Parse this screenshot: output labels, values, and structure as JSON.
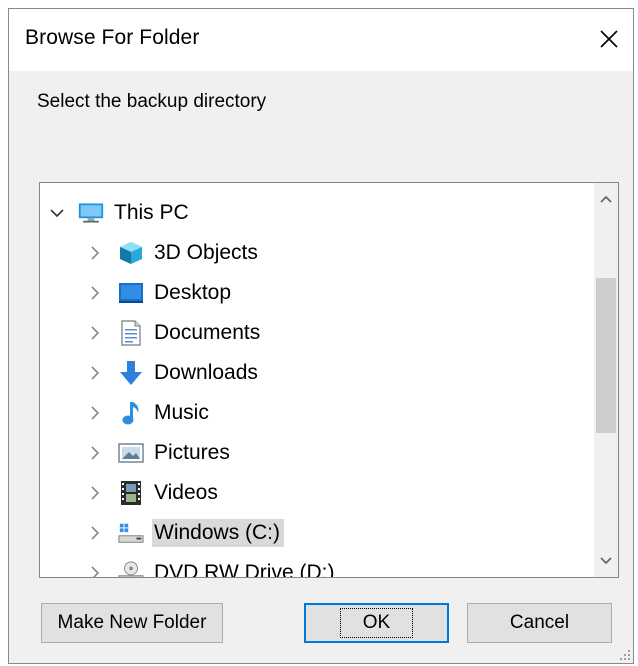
{
  "dialog": {
    "title": "Browse For Folder",
    "prompt": "Select the backup directory"
  },
  "tree": {
    "root": {
      "label": "This PC",
      "icon": "pc-icon",
      "expanded": true
    },
    "items": [
      {
        "label": "3D Objects",
        "icon": "3d-objects-icon",
        "selected": false
      },
      {
        "label": "Desktop",
        "icon": "desktop-icon",
        "selected": false
      },
      {
        "label": "Documents",
        "icon": "documents-icon",
        "selected": false
      },
      {
        "label": "Downloads",
        "icon": "downloads-icon",
        "selected": false
      },
      {
        "label": "Music",
        "icon": "music-icon",
        "selected": false
      },
      {
        "label": "Pictures",
        "icon": "pictures-icon",
        "selected": false
      },
      {
        "label": "Videos",
        "icon": "videos-icon",
        "selected": false
      },
      {
        "label": "Windows (C:)",
        "icon": "drive-icon",
        "selected": true
      },
      {
        "label": "DVD RW Drive (D:)",
        "icon": "dvd-drive-icon",
        "selected": false
      }
    ]
  },
  "buttons": {
    "make_new_folder": "Make New Folder",
    "ok": "OK",
    "cancel": "Cancel"
  },
  "colors": {
    "selection": "#d9d9d9",
    "accent": "#0078d7",
    "scroll_thumb": "#cdcdcd"
  }
}
